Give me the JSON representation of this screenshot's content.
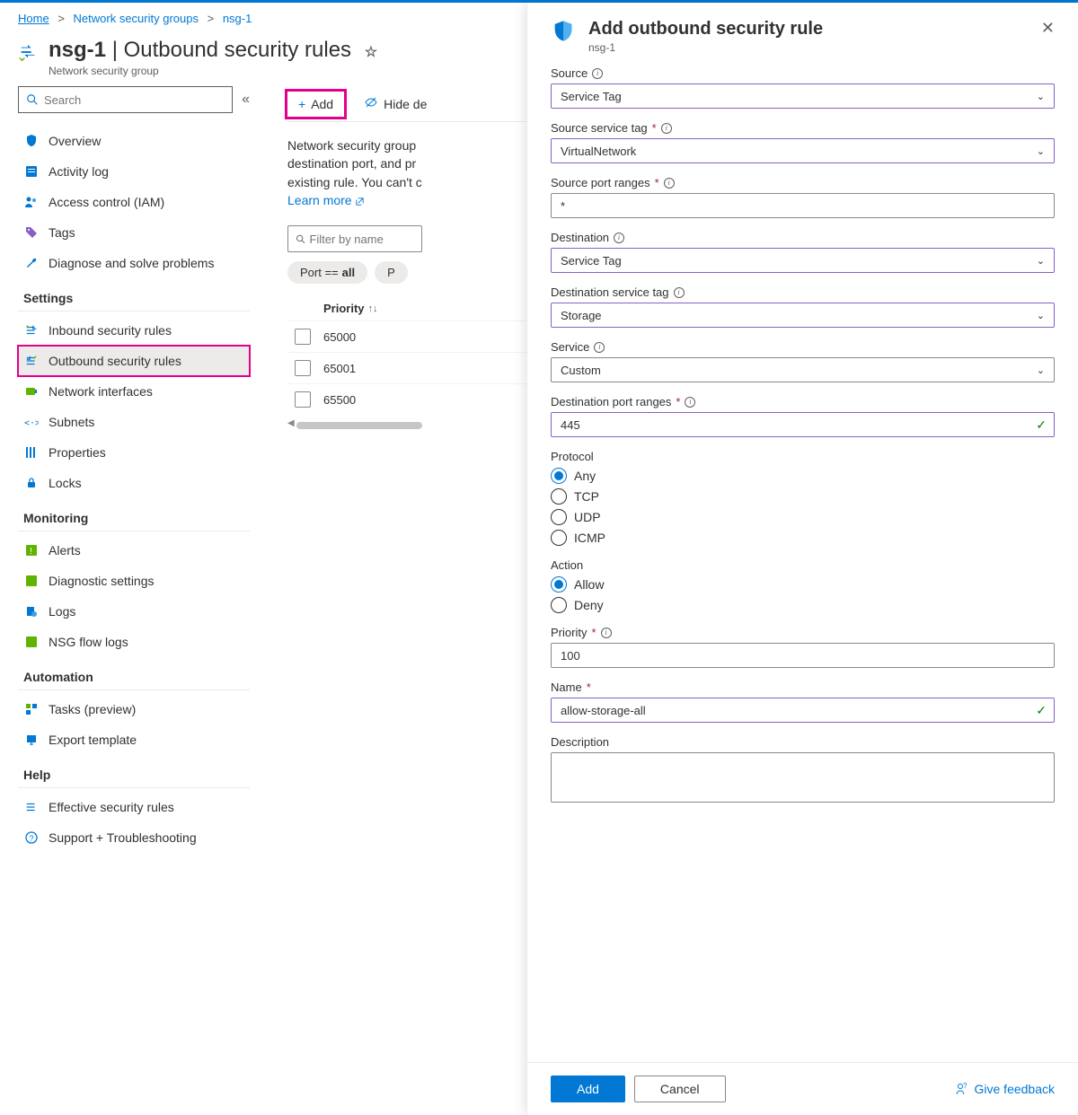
{
  "breadcrumb": {
    "home": "Home",
    "groups": "Network security groups",
    "current": "nsg-1"
  },
  "header": {
    "name": "nsg-1",
    "page": "Outbound security rules",
    "type": "Network security group"
  },
  "sidebar": {
    "search_placeholder": "Search",
    "top": [
      {
        "label": "Overview"
      },
      {
        "label": "Activity log"
      },
      {
        "label": "Access control (IAM)"
      },
      {
        "label": "Tags"
      },
      {
        "label": "Diagnose and solve problems"
      }
    ],
    "settings_label": "Settings",
    "settings": [
      {
        "label": "Inbound security rules"
      },
      {
        "label": "Outbound security rules"
      },
      {
        "label": "Network interfaces"
      },
      {
        "label": "Subnets"
      },
      {
        "label": "Properties"
      },
      {
        "label": "Locks"
      }
    ],
    "monitoring_label": "Monitoring",
    "monitoring": [
      {
        "label": "Alerts"
      },
      {
        "label": "Diagnostic settings"
      },
      {
        "label": "Logs"
      },
      {
        "label": "NSG flow logs"
      }
    ],
    "automation_label": "Automation",
    "automation": [
      {
        "label": "Tasks (preview)"
      },
      {
        "label": "Export template"
      }
    ],
    "help_label": "Help",
    "help": [
      {
        "label": "Effective security rules"
      },
      {
        "label": "Support + Troubleshooting"
      }
    ]
  },
  "toolbar": {
    "add": "Add",
    "hide": "Hide de"
  },
  "desc": {
    "line1": "Network security group",
    "line2": "destination port, and pr",
    "line3": "existing rule. You can't c",
    "learn": "Learn more"
  },
  "filter": {
    "placeholder": "Filter by name",
    "pill_label": "Port ==",
    "pill_value": "all"
  },
  "table": {
    "header": "Priority",
    "rows": [
      "65000",
      "65001",
      "65500"
    ]
  },
  "panel": {
    "title": "Add outbound security rule",
    "sub": "nsg-1",
    "source_label": "Source",
    "source_value": "Service Tag",
    "source_tag_label": "Source service tag",
    "source_tag_value": "VirtualNetwork",
    "source_port_label": "Source port ranges",
    "source_port_value": "*",
    "dest_label": "Destination",
    "dest_value": "Service Tag",
    "dest_tag_label": "Destination service tag",
    "dest_tag_value": "Storage",
    "service_label": "Service",
    "service_value": "Custom",
    "dest_port_label": "Destination port ranges",
    "dest_port_value": "445",
    "protocol_label": "Protocol",
    "protocol_options": [
      "Any",
      "TCP",
      "UDP",
      "ICMP"
    ],
    "action_label": "Action",
    "action_options": [
      "Allow",
      "Deny"
    ],
    "priority_label": "Priority",
    "priority_value": "100",
    "name_label": "Name",
    "name_value": "allow-storage-all",
    "description_label": "Description",
    "add_btn": "Add",
    "cancel_btn": "Cancel",
    "feedback": "Give feedback"
  }
}
